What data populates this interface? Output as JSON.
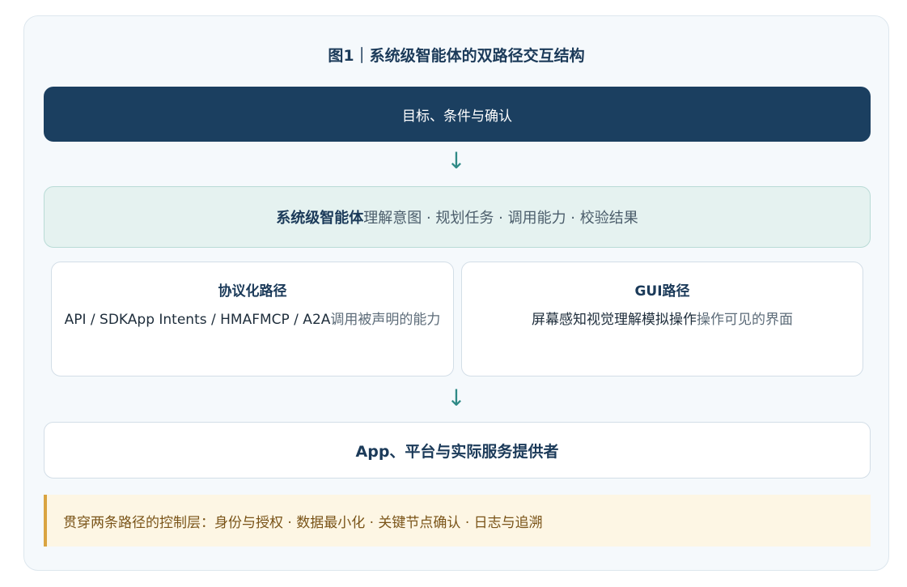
{
  "figure": {
    "title": "图1｜系统级智能体的双路径交互结构"
  },
  "goal": {
    "label": "目标、条件与确认"
  },
  "arrows": {
    "down_glyph": "↓"
  },
  "agent": {
    "name": "系统级智能体",
    "functions": "理解意图 · 规划任务 · 调用能力 · 校验结果"
  },
  "protocol_path": {
    "title": "协议化路径",
    "items": "API / SDKApp Intents / HMAFMCP / A2A",
    "description": "调用被声明的能力"
  },
  "gui_path": {
    "title": "GUI路径",
    "items": "屏幕感知视觉理解模拟操作",
    "description": "操作可见的界面"
  },
  "provider": {
    "label": "App、平台与实际服务提供者"
  },
  "control_layer": {
    "label": "贯穿两条路径的控制层：身份与授权 · 数据最小化 · 关键节点确认 · 日志与追溯"
  },
  "colors": {
    "navy": "#1b3f60",
    "teal_arrow": "#2f8a86",
    "agent_bg": "#e5f2f0",
    "control_bg": "#fdf6e4",
    "control_accent": "#d9a441"
  }
}
